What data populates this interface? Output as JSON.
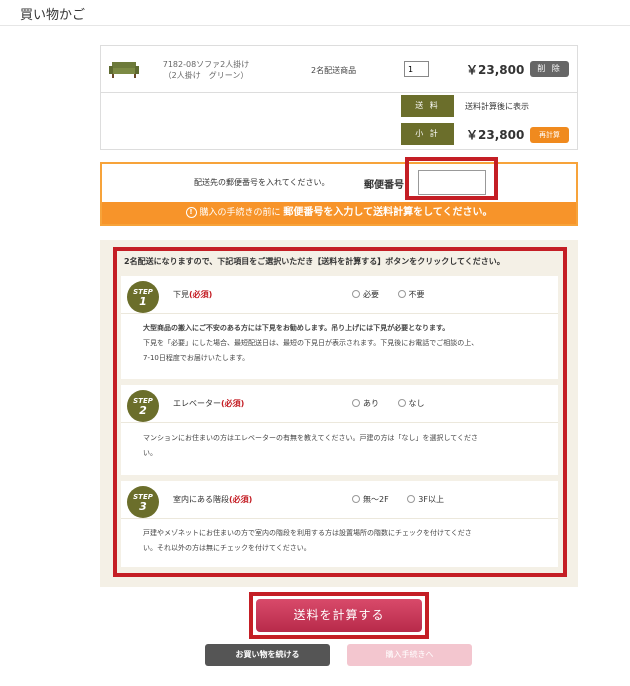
{
  "page": {
    "title": "買い物かご"
  },
  "cart": {
    "item": {
      "name_line1": "7182-08ソファ2人掛け",
      "name_line2": "（2人掛け　グリーン）",
      "shipping_type": "2名配送商品",
      "quantity": "1",
      "price": "￥23,800",
      "delete_label": "削 除"
    },
    "shipping_label": "送 料",
    "shipping_note": "送料計算後に表示",
    "subtotal_label": "小 計",
    "subtotal": "￥23,800",
    "recalc_label": "再計算"
  },
  "postal": {
    "prompt": "配送先の郵便番号を入れてください。",
    "label": "郵便番号",
    "input_value": "",
    "banner_pre": "購入の手続きの前に ",
    "banner_strong": "郵便番号を入力して送料計算をしてください。",
    "warn_glyph": "!"
  },
  "steps": {
    "header": "2名配送になりますので、下記項目をご選択いただき【送料を計算する】ボタンをクリックしてください。",
    "required": "(必須)",
    "badge_word": "STEP",
    "items": [
      {
        "num": "1",
        "title": "下見",
        "options": [
          "必要",
          "不要"
        ],
        "desc_lines": [
          "大型商品の搬入にご不安のある方には下見をお勧めします。吊り上げには下見が必要となります。",
          "下見を「必要」にした場合、最短配送日は、最短の下見日が表示されます。下見後にお電話でご相談の上、",
          "7-10日程度でお届けいたします。"
        ]
      },
      {
        "num": "2",
        "title": "エレベーター",
        "options": [
          "あり",
          "なし"
        ],
        "desc_lines": [
          "マンションにお住まいの方はエレベーターの有無を教えてください。戸建の方は「なし」を選択してくださ",
          "い。"
        ]
      },
      {
        "num": "3",
        "title": "室内にある階段",
        "options": [
          "無～2F",
          "3F以上"
        ],
        "desc_lines": [
          "戸建やメゾネットにお住まいの方で室内の階段を利用する方は設置場所の階数にチェックを付けてくださ",
          "い。それ以外の方は無にチェックを付けてください。"
        ]
      }
    ]
  },
  "buttons": {
    "calc_shipping": "送料を計算する",
    "continue_shopping": "お買い物を続ける",
    "proceed_checkout": "購入手続きへ"
  },
  "colors": {
    "olive": "#6b6e2b",
    "orange": "#f7942a",
    "highlight_red": "#c41e25",
    "calc_button": "#c83a5a"
  }
}
